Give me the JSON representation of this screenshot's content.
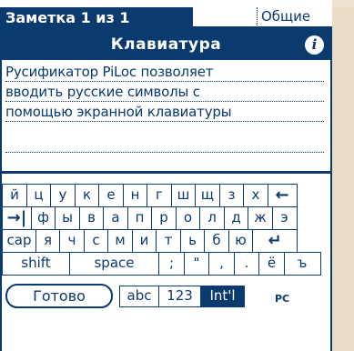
{
  "title_bar": {
    "title": "Заметка 1 из 1",
    "category": "Общие"
  },
  "dialog": {
    "title": "Клавиатура",
    "info_icon": "info-icon"
  },
  "note": {
    "lines": [
      "Русификатор PiLoc позволяет",
      "вводить русские символы с",
      "помощью экранной клавиатуры",
      ""
    ]
  },
  "keyboard": {
    "rows": [
      [
        "й",
        "ц",
        "у",
        "к",
        "е",
        "н",
        "г",
        "ш",
        "щ",
        "з",
        "х",
        "←"
      ],
      [
        "→|",
        "ф",
        "ы",
        "в",
        "а",
        "п",
        "р",
        "о",
        "л",
        "д",
        "ж",
        "э"
      ],
      [
        "cap",
        "я",
        "ч",
        "с",
        "м",
        "и",
        "т",
        "ь",
        "б",
        "ю",
        "↵"
      ],
      [
        "shift",
        "space",
        ";",
        "\"",
        ",",
        ".",
        "ё",
        "ъ"
      ]
    ]
  },
  "bottom": {
    "done_label": "Готово",
    "modes": [
      "abc",
      "123",
      "Int'l"
    ],
    "active_mode": "Int'l",
    "pc_label": "PC"
  },
  "colors": {
    "accent": "#0a3a6e",
    "background": "#ffffff",
    "desk": "#e8dcc6"
  }
}
